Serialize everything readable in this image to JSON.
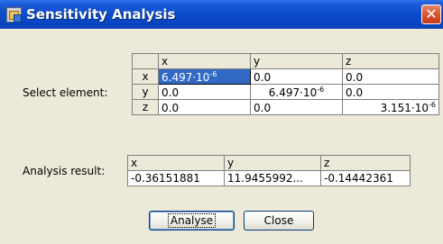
{
  "window": {
    "title": "Sensitivity Analysis",
    "close_glyph": "✕"
  },
  "select": {
    "label": "Select element:",
    "columns": [
      "x",
      "y",
      "z"
    ],
    "rows": [
      {
        "header": "x",
        "cells": [
          {
            "base": "6.497·10",
            "exp": "-6"
          },
          {
            "base": "0.0",
            "exp": ""
          },
          {
            "base": "0.0",
            "exp": ""
          }
        ]
      },
      {
        "header": "y",
        "cells": [
          {
            "base": "0.0",
            "exp": ""
          },
          {
            "base": "6.497·10",
            "exp": "-6"
          },
          {
            "base": "0.0",
            "exp": ""
          }
        ]
      },
      {
        "header": "z",
        "cells": [
          {
            "base": "0.0",
            "exp": ""
          },
          {
            "base": "0.0",
            "exp": ""
          },
          {
            "base": "3.151·10",
            "exp": "-6"
          }
        ]
      }
    ],
    "selected_cell": {
      "row": 0,
      "col": 0
    }
  },
  "result": {
    "label": "Analysis result:",
    "columns": [
      "x",
      "y",
      "z"
    ],
    "values": [
      "-0.36151881",
      "11.9455992...",
      "-0.14442361"
    ]
  },
  "buttons": {
    "analyse": "Analyse",
    "close": "Close"
  },
  "colors": {
    "titlebar": "#0a4bc8",
    "selection": "#316ac5",
    "dialog_bg": "#ece9d8"
  },
  "icons": {
    "app": "app-window-icon",
    "close": "close-icon"
  }
}
